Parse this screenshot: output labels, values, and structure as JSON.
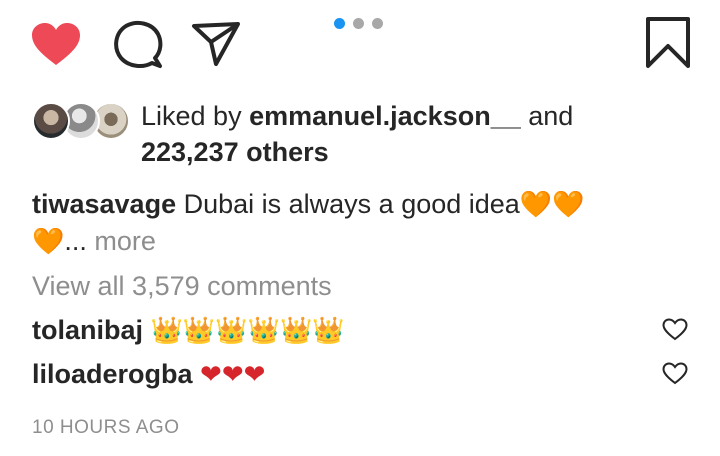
{
  "actions": {
    "like_icon": "heart-filled-icon",
    "comment_icon": "comment-bubble-icon",
    "share_icon": "paper-plane-icon",
    "save_icon": "bookmark-icon",
    "like_color": "#ed4956"
  },
  "carousel": {
    "count": 3,
    "active_index": 0,
    "active_color": "#1a94f0"
  },
  "likes": {
    "prefix": "Liked by",
    "username": "emmanuel.jackson__",
    "conjunction": "and",
    "others": "223,237 others"
  },
  "caption": {
    "username": "tiwasavage",
    "text": "Dubai is always a good idea",
    "emoji_inline": "🧡🧡",
    "emoji_line2": "🧡",
    "ellipsis": "...",
    "more": "more"
  },
  "view_all_comments": "View all 3,579 comments",
  "comments": [
    {
      "username": "tolanibaj",
      "emoji": "👑👑👑👑👑👑"
    },
    {
      "username": "liloaderogba",
      "emoji": "❤❤❤"
    }
  ],
  "timestamp": "10 HOURS AGO"
}
